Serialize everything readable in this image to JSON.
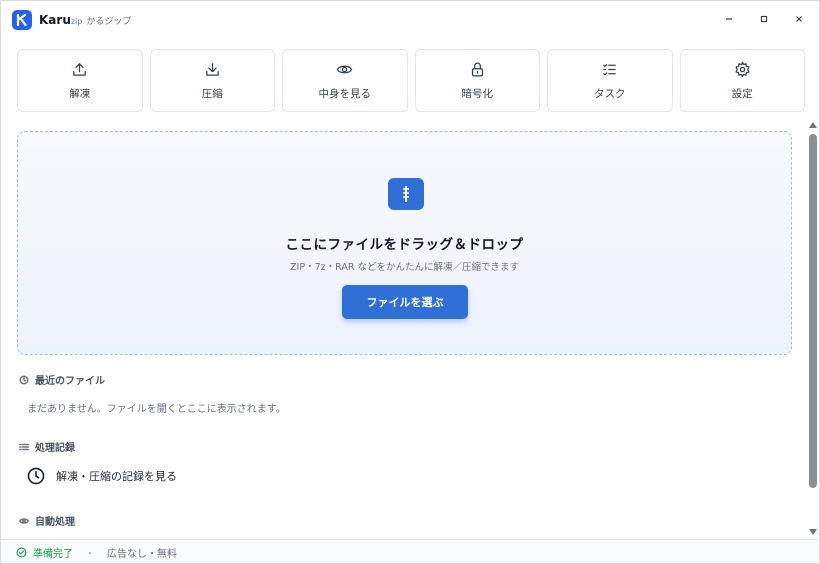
{
  "window": {
    "brand": "Karu",
    "brand_suffix": "zip",
    "subtitle": "かるジップ",
    "controls": {
      "minimize": "–",
      "maximize": "□",
      "close": "×"
    }
  },
  "toolbar": {
    "items": [
      {
        "label": "解凍",
        "icon": "upload-icon"
      },
      {
        "label": "圧縮",
        "icon": "download-icon"
      },
      {
        "label": "中身を見る",
        "icon": "eye-icon"
      },
      {
        "label": "暗号化",
        "icon": "lock-icon"
      },
      {
        "label": "タスク",
        "icon": "checklist-icon"
      },
      {
        "label": "設定",
        "icon": "gear-icon"
      }
    ]
  },
  "dropzone": {
    "title": "ここにファイルをドラッグ＆ドロップ",
    "subtitle": "ZIP・7z・RAR などをかんたんに解凍／圧縮できます",
    "button_label": "ファイルを選ぶ"
  },
  "recent": {
    "heading": "最近のファイル",
    "empty_text": "まだありません。ファイルを開くとここに表示されます。"
  },
  "history": {
    "heading": "処理記録",
    "link_label": "解凍・圧縮の記録を見る"
  },
  "auto": {
    "heading": "自動処理"
  },
  "status": {
    "ready": "準備完了",
    "separator": "・",
    "info": "広告なし・無料"
  },
  "colors": {
    "accent": "#2f6fd6",
    "status_ok": "#16a34a"
  }
}
